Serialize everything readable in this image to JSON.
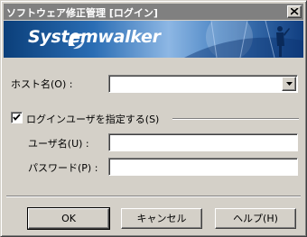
{
  "window": {
    "title": "ソフトウェア修正管理 [ログイン]"
  },
  "banner": {
    "brand": "Systemwalker"
  },
  "form": {
    "host_label": "ホスト名(O) :",
    "host_value": "",
    "specify_user_label": "ログインユーザを指定する(S)",
    "specify_user_checked": true,
    "user_label": "ユーザ名(U) :",
    "user_value": "",
    "password_label": "パスワード(P) :",
    "password_value": ""
  },
  "buttons": {
    "ok": "OK",
    "cancel": "キャンセル",
    "help": "ヘルプ(H)"
  },
  "icons": [
    "close-icon",
    "systemwalker-logo-icon",
    "dropdown-arrow-icon",
    "checkmark-icon"
  ],
  "colors": {
    "banner_dark": "#0b3f7a",
    "banner_light": "#8db7e4",
    "face": "#d4d0c8"
  }
}
